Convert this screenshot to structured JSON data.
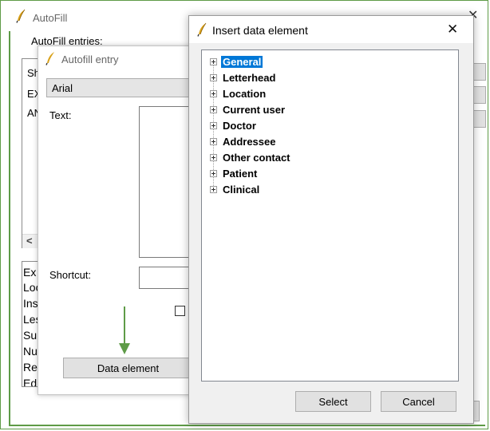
{
  "autofill_window": {
    "title": "AutoFill",
    "entries_label": "AutoFill entries:",
    "list_rows": [
      "Sh",
      "EX",
      "AN"
    ],
    "scroll_left": "<",
    "lower_rows": [
      "Ex",
      "Loc",
      "Ins",
      "Les",
      "Su",
      "Nu",
      "Re",
      "Ed"
    ]
  },
  "entry_window": {
    "title": "Autofill entry",
    "font_value": "Arial",
    "text_label": "Text:",
    "shortcut_label": "Shortcut:",
    "data_element_button": "Data element"
  },
  "dialog": {
    "title": "Insert data element",
    "close": "✕",
    "tree_items": [
      {
        "label": "General",
        "selected": true
      },
      {
        "label": "Letterhead",
        "selected": false
      },
      {
        "label": "Location",
        "selected": false
      },
      {
        "label": "Current user",
        "selected": false
      },
      {
        "label": "Doctor",
        "selected": false
      },
      {
        "label": "Addressee",
        "selected": false
      },
      {
        "label": "Other contact",
        "selected": false
      },
      {
        "label": "Patient",
        "selected": false
      },
      {
        "label": "Clinical",
        "selected": false
      }
    ],
    "select_button": "Select",
    "cancel_button": "Cancel"
  },
  "colors": {
    "annotation_green": "#5e9b47",
    "selection_blue": "#0078d7"
  }
}
